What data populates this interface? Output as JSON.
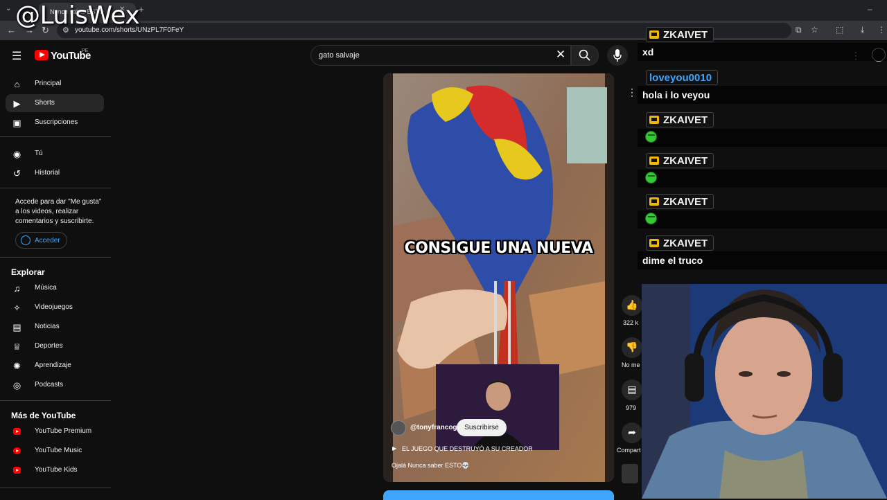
{
  "browser": {
    "tab_title": "Nunca saber ESTO",
    "url": "youtube.com/shorts/UNzPL7F0FeY"
  },
  "watermark": "@LuisWex",
  "header": {
    "logo_text": "YouTube",
    "country_code": "PE",
    "search_value": "gato salvaje"
  },
  "sidebar": {
    "main": [
      {
        "label": "Principal",
        "icon": "home-icon"
      },
      {
        "label": "Shorts",
        "icon": "shorts-icon"
      },
      {
        "label": "Suscripciones",
        "icon": "subscriptions-icon"
      }
    ],
    "you": [
      {
        "label": "Tú",
        "icon": "user-icon"
      },
      {
        "label": "Historial",
        "icon": "history-icon"
      }
    ],
    "signin_note": "Accede para dar \"Me gusta\" a los videos, realizar comentarios y suscribirte.",
    "signin_label": "Acceder",
    "explore_heading": "Explorar",
    "explore": [
      {
        "label": "Música",
        "icon": "music-icon"
      },
      {
        "label": "Videojuegos",
        "icon": "gaming-icon"
      },
      {
        "label": "Noticias",
        "icon": "news-icon"
      },
      {
        "label": "Deportes",
        "icon": "trophy-icon"
      },
      {
        "label": "Aprendizaje",
        "icon": "lightbulb-icon"
      },
      {
        "label": "Podcasts",
        "icon": "podcast-icon"
      }
    ],
    "more_heading": "Más de YouTube",
    "more": [
      {
        "label": "YouTube Premium"
      },
      {
        "label": "YouTube Music"
      },
      {
        "label": "YouTube Kids"
      }
    ]
  },
  "short": {
    "overlay_text": "CONSIGUE UNA NUEVA",
    "channel": "@tonyfrancog",
    "subscribe_label": "Suscribirse",
    "playlist_title": "EL JUEGO QUE DESTRUYÓ A SU CREADOR",
    "title": "Ojalá Nunca saber ESTO💀"
  },
  "actions": {
    "likes": "322 k",
    "dislike_label": "No me",
    "comments": "979",
    "share_label": "Compart"
  },
  "chat": [
    {
      "user": "ZKAIVET",
      "badge": "crown",
      "message": "xd"
    },
    {
      "user": "loveyou0010",
      "badge": "none",
      "message": "hola i lo veyou"
    },
    {
      "user": "ZKAIVET",
      "badge": "crown",
      "message": "emote"
    },
    {
      "user": "ZKAIVET",
      "badge": "crown",
      "message": "emote"
    },
    {
      "user": "ZKAIVET",
      "badge": "crown",
      "message": "emote"
    },
    {
      "user": "ZKAIVET",
      "badge": "crown",
      "message": "dime el truco"
    }
  ],
  "colors": {
    "background": "#0f0f0f",
    "accent_blue": "#3ea6ff",
    "youtube_red": "#ff0000",
    "chat_user_blue": "#3ea6ff",
    "crown_gold": "#f2b705"
  }
}
